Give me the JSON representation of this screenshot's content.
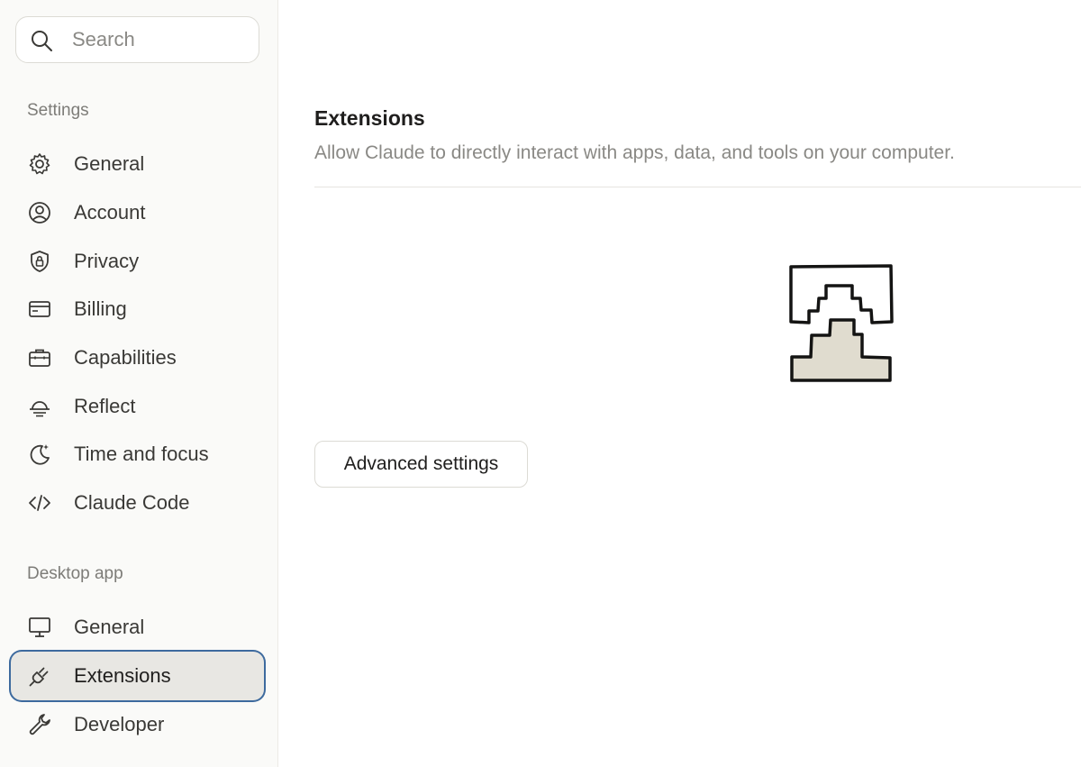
{
  "search": {
    "placeholder": "Search",
    "icon": "search-icon"
  },
  "sidebar": {
    "settings_label": "Settings",
    "settings_items": [
      {
        "label": "General",
        "icon": "gear-icon"
      },
      {
        "label": "Account",
        "icon": "user-circle-icon"
      },
      {
        "label": "Privacy",
        "icon": "shield-lock-icon"
      },
      {
        "label": "Billing",
        "icon": "credit-card-icon"
      },
      {
        "label": "Capabilities",
        "icon": "briefcase-icon"
      },
      {
        "label": "Reflect",
        "icon": "sunrise-icon"
      },
      {
        "label": "Time and focus",
        "icon": "moon-sparkle-icon"
      },
      {
        "label": "Claude Code",
        "icon": "code-icon"
      }
    ],
    "desktop_label": "Desktop app",
    "desktop_items": [
      {
        "label": "General",
        "icon": "monitor-icon"
      },
      {
        "label": "Extensions",
        "icon": "plug-icon",
        "active": true
      },
      {
        "label": "Developer",
        "icon": "wrench-icon"
      }
    ]
  },
  "main": {
    "title": "Extensions",
    "subtitle": "Allow Claude to directly interact with apps, data, and tools on your computer.",
    "advanced_button": "Advanced settings"
  },
  "colors": {
    "sidebar_bg": "#fafaf8",
    "active_bg": "#e8e7e3",
    "focus_ring": "#3d6a9e",
    "illustration_fill": "#e0dccf"
  }
}
